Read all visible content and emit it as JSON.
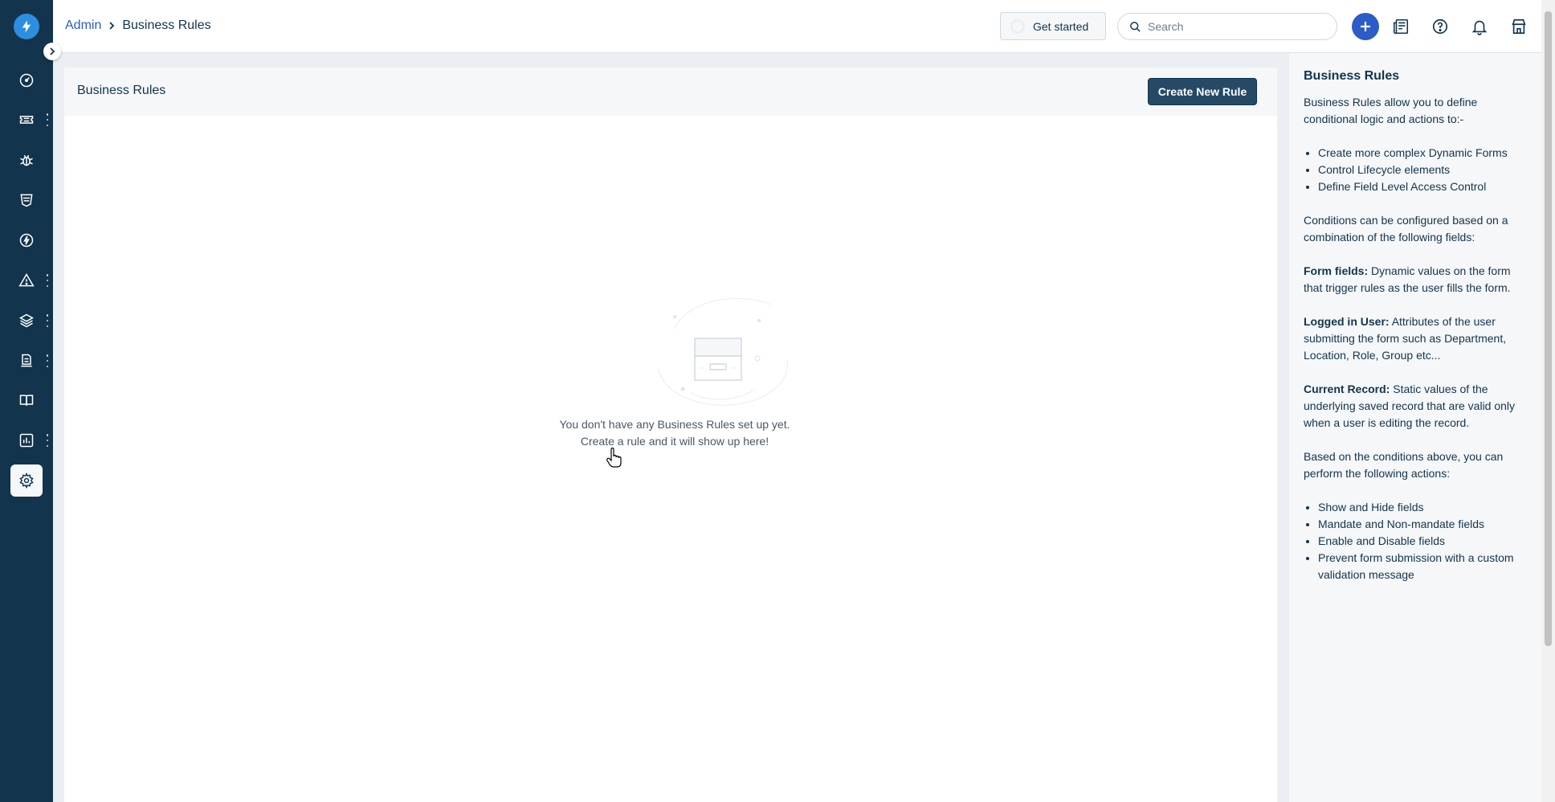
{
  "app": {
    "name": "Freshservice"
  },
  "sidebar": {
    "items": [
      {
        "icon": "dashboard-icon",
        "has_menu": false
      },
      {
        "icon": "ticket-icon",
        "has_menu": true
      },
      {
        "icon": "bug-icon",
        "has_menu": false
      },
      {
        "icon": "shield-icon",
        "has_menu": false
      },
      {
        "icon": "lightning-icon",
        "has_menu": false
      },
      {
        "icon": "warning-icon",
        "has_menu": true
      },
      {
        "icon": "layers-icon",
        "has_menu": true
      },
      {
        "icon": "assets-icon",
        "has_menu": true
      },
      {
        "icon": "book-icon",
        "has_menu": false
      },
      {
        "icon": "reports-icon",
        "has_menu": true
      },
      {
        "icon": "gear-icon",
        "has_menu": false,
        "active": true
      }
    ]
  },
  "header": {
    "breadcrumb_parent": "Admin",
    "breadcrumb_current": "Business Rules",
    "get_started_label": "Get started",
    "search_placeholder": "Search"
  },
  "main": {
    "title": "Business Rules",
    "create_button_label": "Create New Rule",
    "empty_line1": "You don't have any Business Rules set up yet.",
    "empty_line2": "Create a rule and it will show up here!"
  },
  "help": {
    "title": "Business Rules",
    "intro": "Business Rules allow you to define conditional logic and actions to:-",
    "capabilities": [
      "Create more complex Dynamic Forms",
      "Control Lifecycle elements",
      "Define Field Level Access Control"
    ],
    "conditions_intro": "Conditions can be configured based on a combination of the following fields:",
    "form_fields_label": "Form fields:",
    "form_fields_text": "Dynamic values on the form that trigger rules as the user fills the form.",
    "logged_user_label": "Logged in User:",
    "logged_user_text": "Attributes of the user submitting the form such as Department, Location, Role, Group etc...",
    "current_record_label": "Current Record:",
    "current_record_text": "Static values of the underlying saved record that are valid only when a user is editing the record.",
    "actions_intro": "Based on the conditions above, you can perform the following actions:",
    "actions": [
      "Show and Hide fields",
      "Mandate and Non-mandate fields",
      "Enable and Disable fields",
      "Prevent form submission with a custom validation message"
    ]
  },
  "colors": {
    "sidebar_bg": "#12344d",
    "accent": "#2c5cc5",
    "button_bg": "#264966"
  }
}
